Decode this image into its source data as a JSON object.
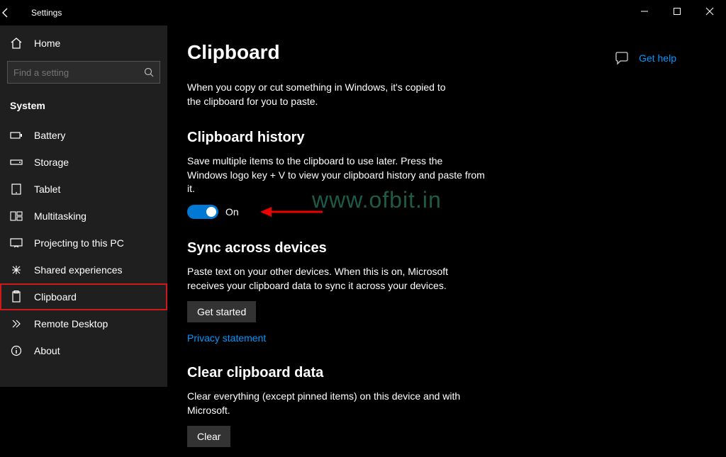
{
  "window": {
    "title": "Settings"
  },
  "sidebar": {
    "home": "Home",
    "searchPlaceholder": "Find a setting",
    "header": "System",
    "items": [
      {
        "label": "Battery"
      },
      {
        "label": "Storage"
      },
      {
        "label": "Tablet"
      },
      {
        "label": "Multitasking"
      },
      {
        "label": "Projecting to this PC"
      },
      {
        "label": "Shared experiences"
      },
      {
        "label": "Clipboard"
      },
      {
        "label": "Remote Desktop"
      },
      {
        "label": "About"
      }
    ]
  },
  "main": {
    "title": "Clipboard",
    "intro": "When you copy or cut something in Windows, it's copied to the clipboard for you to paste.",
    "history": {
      "heading": "Clipboard history",
      "desc": "Save multiple items to the clipboard to use later. Press the Windows logo key + V to view your clipboard history and paste from it.",
      "toggleState": "On"
    },
    "sync": {
      "heading": "Sync across devices",
      "desc": "Paste text on your other devices. When this is on, Microsoft receives your clipboard data to sync it across your devices.",
      "button": "Get started",
      "link": "Privacy statement"
    },
    "clear": {
      "heading": "Clear clipboard data",
      "desc": "Clear everything (except pinned items) on this device and with Microsoft.",
      "button": "Clear"
    }
  },
  "help": {
    "label": "Get help"
  },
  "watermark": "www.ofbit.in"
}
